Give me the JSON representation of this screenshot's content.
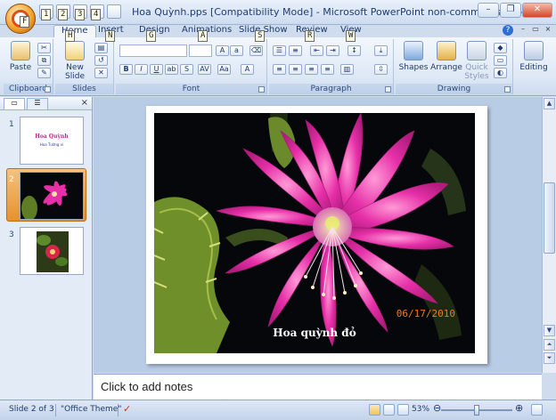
{
  "window": {
    "title": "Hoa Quỳnh.pps [Compatibility Mode] - Microsoft PowerPoint non-commercial use"
  },
  "quick_access_keytips": [
    "F",
    "1",
    "2",
    "3",
    "4"
  ],
  "tabs": [
    {
      "label": "Home",
      "keytip": "H",
      "active": true
    },
    {
      "label": "Insert",
      "keytip": "N"
    },
    {
      "label": "Design",
      "keytip": "G"
    },
    {
      "label": "Animations",
      "keytip": "A"
    },
    {
      "label": "Slide Show",
      "keytip": "S"
    },
    {
      "label": "Review",
      "keytip": "R"
    },
    {
      "label": "View",
      "keytip": "W"
    }
  ],
  "ribbon": {
    "clipboard": {
      "label": "Clipboard",
      "paste": "Paste"
    },
    "slides": {
      "label": "Slides",
      "new_slide": "New Slide"
    },
    "font": {
      "label": "Font"
    },
    "paragraph": {
      "label": "Paragraph"
    },
    "drawing": {
      "label": "Drawing",
      "shapes": "Shapes",
      "arrange": "Arrange",
      "quick_styles": "Quick Styles"
    },
    "editing": {
      "label": "Editing"
    }
  },
  "thumbnails": [
    {
      "num": "1",
      "title": "Hoa Quỳnh",
      "subtitle": "Hoa Tường vi"
    },
    {
      "num": "2"
    },
    {
      "num": "3"
    }
  ],
  "slide": {
    "date_stamp": "06/17/2010",
    "caption": "Hoa quỳnh đỏ"
  },
  "notes": {
    "placeholder": "Click to add notes"
  },
  "status": {
    "slide_info": "Slide 2 of 3",
    "theme": "\"Office Theme\"",
    "zoom": "53%"
  },
  "colors": {
    "flower": "#e62fa8",
    "leaf": "#6f8f2a",
    "date": "#f07a1d"
  }
}
